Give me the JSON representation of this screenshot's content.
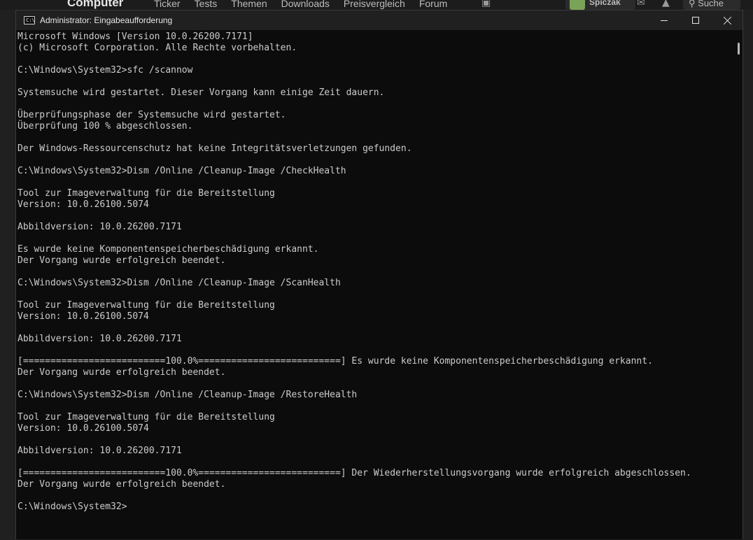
{
  "background_site": {
    "logo": "Computer",
    "nav": [
      "Ticker",
      "Tests",
      "Themen",
      "Downloads",
      "Preisvergleich",
      "Forum"
    ],
    "user_name": "Spiczak",
    "search_label": "Suche"
  },
  "window": {
    "title": "Administrator: Eingabeaufforderung",
    "icon_text": "C:\\"
  },
  "console_lines": [
    "Microsoft Windows [Version 10.0.26200.7171]",
    "(c) Microsoft Corporation. Alle Rechte vorbehalten.",
    "",
    "C:\\Windows\\System32>sfc /scannow",
    "",
    "Systemsuche wird gestartet. Dieser Vorgang kann einige Zeit dauern.",
    "",
    "Überprüfungsphase der Systemsuche wird gestartet.",
    "Überprüfung 100 % abgeschlossen.",
    "",
    "Der Windows-Ressourcenschutz hat keine Integritätsverletzungen gefunden.",
    "",
    "C:\\Windows\\System32>Dism /Online /Cleanup-Image /CheckHealth",
    "",
    "Tool zur Imageverwaltung für die Bereitstellung",
    "Version: 10.0.26100.5074",
    "",
    "Abbildversion: 10.0.26200.7171",
    "",
    "Es wurde keine Komponentenspeicherbeschädigung erkannt.",
    "Der Vorgang wurde erfolgreich beendet.",
    "",
    "C:\\Windows\\System32>Dism /Online /Cleanup-Image /ScanHealth",
    "",
    "Tool zur Imageverwaltung für die Bereitstellung",
    "Version: 10.0.26100.5074",
    "",
    "Abbildversion: 10.0.26200.7171",
    "",
    "[==========================100.0%==========================] Es wurde keine Komponentenspeicherbeschädigung erkannt.",
    "Der Vorgang wurde erfolgreich beendet.",
    "",
    "C:\\Windows\\System32>Dism /Online /Cleanup-Image /RestoreHealth",
    "",
    "Tool zur Imageverwaltung für die Bereitstellung",
    "Version: 10.0.26100.5074",
    "",
    "Abbildversion: 10.0.26200.7171",
    "",
    "[==========================100.0%==========================] Der Wiederherstellungsvorgang wurde erfolgreich abgeschlossen.",
    "Der Vorgang wurde erfolgreich beendet.",
    "",
    "C:\\Windows\\System32>"
  ],
  "colors": {
    "console_bg": "#0c0c0c",
    "console_fg": "#cccccc",
    "titlebar_bg": "#202020"
  }
}
